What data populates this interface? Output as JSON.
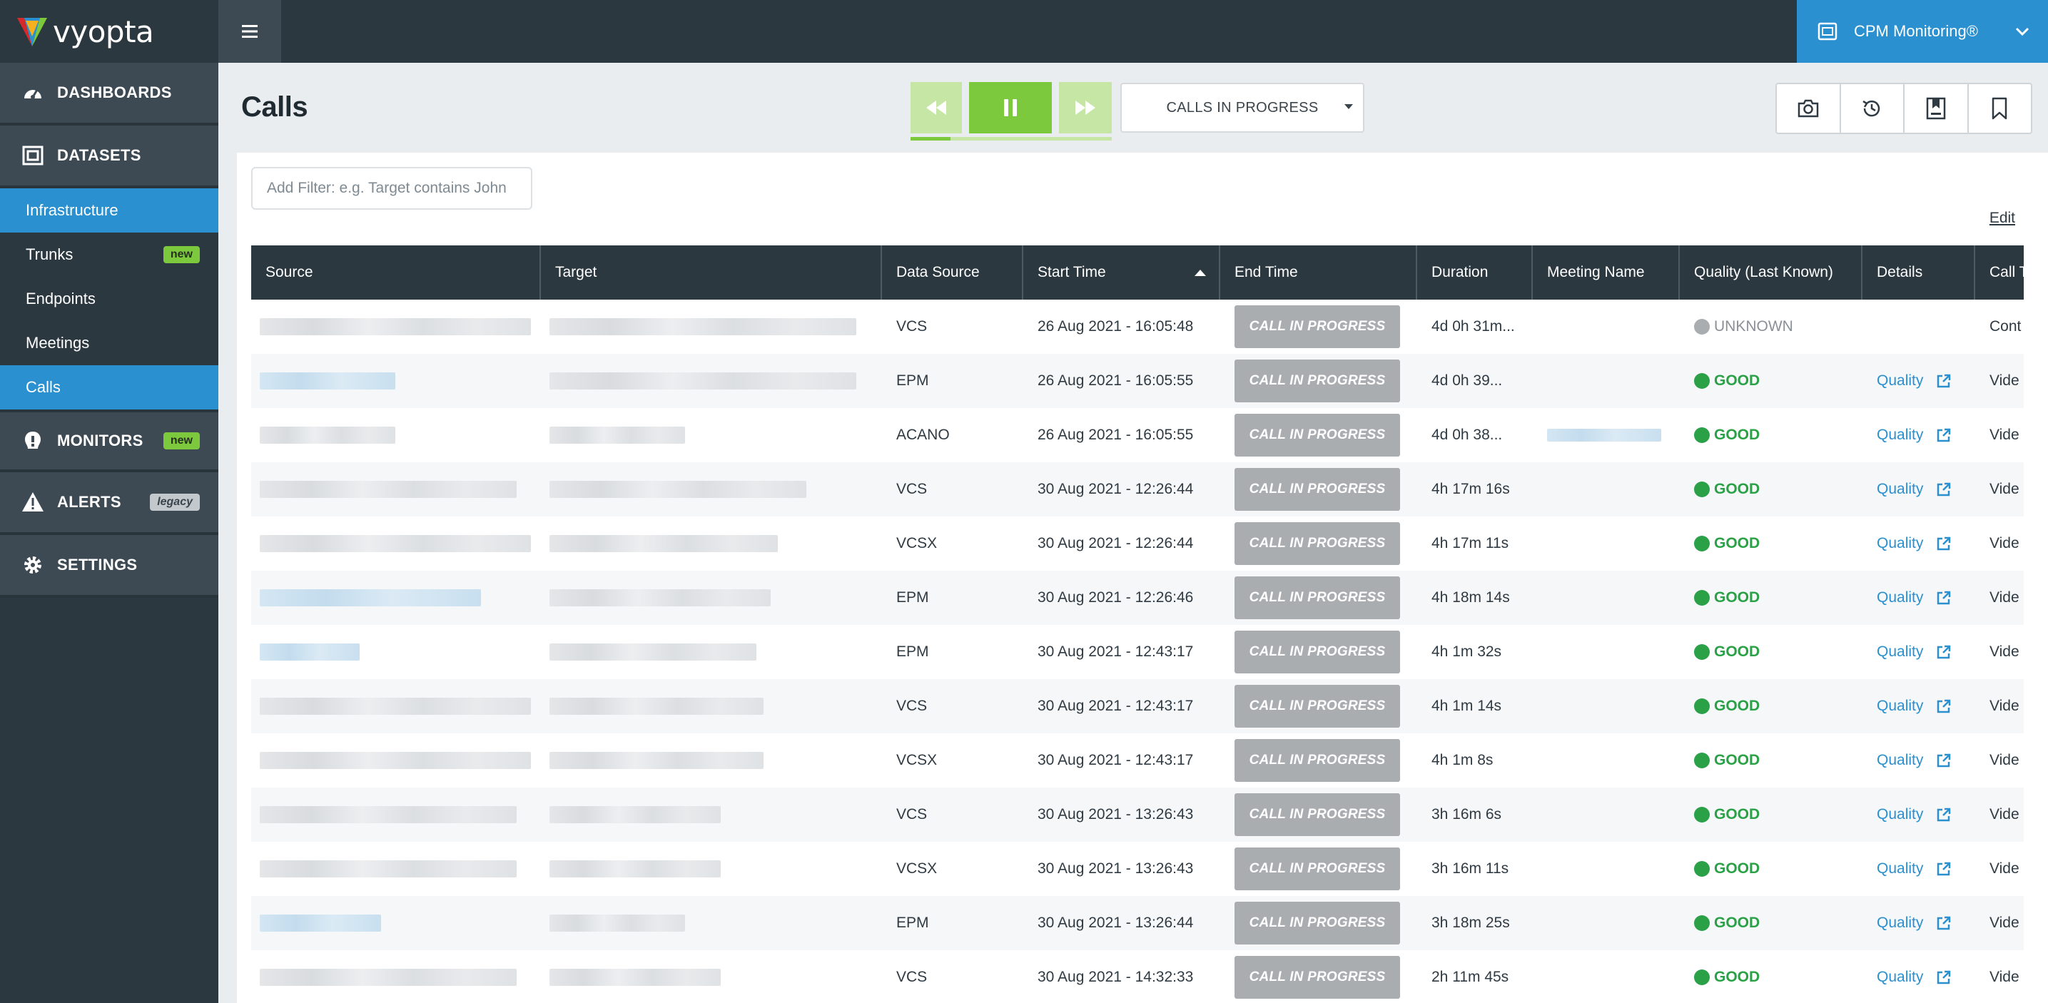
{
  "brand": {
    "name": "vyopta"
  },
  "product": {
    "name": "CPM Monitoring®"
  },
  "sidebar": {
    "dashboards": "DASHBOARDS",
    "datasets": "DATASETS",
    "dataset_items": [
      "Infrastructure",
      "Trunks",
      "Endpoints",
      "Meetings",
      "Calls"
    ],
    "trunks_badge": "new",
    "monitors": "MONITORS",
    "monitors_badge": "new",
    "alerts": "ALERTS",
    "alerts_badge": "legacy",
    "settings": "SETTINGS"
  },
  "page": {
    "title": "Calls"
  },
  "playback": {
    "progress_fraction": 0.2
  },
  "mode_select": {
    "selected": "CALLS IN PROGRESS"
  },
  "filter": {
    "placeholder": "Add Filter: e.g. Target contains John",
    "value": ""
  },
  "edit_label": "Edit",
  "table": {
    "columns": [
      "Source",
      "Target",
      "Data Source",
      "Start Time",
      "End Time",
      "Duration",
      "Meeting Name",
      "Quality (Last Known)",
      "Details",
      "Call T"
    ],
    "sorted_column": "Start Time",
    "rows": [
      {
        "data_source": "VCS",
        "start": "26 Aug 2021 - 16:05:48",
        "end": "CALL IN PROGRESS",
        "duration": "4d 0h 31m...",
        "meeting": "",
        "quality": "UNKNOWN",
        "details": "",
        "call_type": "Cont"
      },
      {
        "data_source": "EPM",
        "start": "26 Aug 2021 - 16:05:55",
        "end": "CALL IN PROGRESS",
        "duration": "4d 0h 39...",
        "meeting": "",
        "quality": "GOOD",
        "details": "Quality",
        "call_type": "Vide"
      },
      {
        "data_source": "ACANO",
        "start": "26 Aug 2021 - 16:05:55",
        "end": "CALL IN PROGRESS",
        "duration": "4d 0h 38...",
        "meeting": "",
        "quality": "GOOD",
        "details": "Quality",
        "call_type": "Vide"
      },
      {
        "data_source": "VCS",
        "start": "30 Aug 2021 - 12:26:44",
        "end": "CALL IN PROGRESS",
        "duration": "4h 17m 16s",
        "meeting": "",
        "quality": "GOOD",
        "details": "Quality",
        "call_type": "Vide"
      },
      {
        "data_source": "VCSX",
        "start": "30 Aug 2021 - 12:26:44",
        "end": "CALL IN PROGRESS",
        "duration": "4h 17m 11s",
        "meeting": "",
        "quality": "GOOD",
        "details": "Quality",
        "call_type": "Vide"
      },
      {
        "data_source": "EPM",
        "start": "30 Aug 2021 - 12:26:46",
        "end": "CALL IN PROGRESS",
        "duration": "4h 18m 14s",
        "meeting": "",
        "quality": "GOOD",
        "details": "Quality",
        "call_type": "Vide"
      },
      {
        "data_source": "EPM",
        "start": "30 Aug 2021 - 12:43:17",
        "end": "CALL IN PROGRESS",
        "duration": "4h 1m 32s",
        "meeting": "",
        "quality": "GOOD",
        "details": "Quality",
        "call_type": "Vide"
      },
      {
        "data_source": "VCS",
        "start": "30 Aug 2021 - 12:43:17",
        "end": "CALL IN PROGRESS",
        "duration": "4h 1m 14s",
        "meeting": "",
        "quality": "GOOD",
        "details": "Quality",
        "call_type": "Vide"
      },
      {
        "data_source": "VCSX",
        "start": "30 Aug 2021 - 12:43:17",
        "end": "CALL IN PROGRESS",
        "duration": "4h 1m 8s",
        "meeting": "",
        "quality": "GOOD",
        "details": "Quality",
        "call_type": "Vide"
      },
      {
        "data_source": "VCS",
        "start": "30 Aug 2021 - 13:26:43",
        "end": "CALL IN PROGRESS",
        "duration": "3h 16m 6s",
        "meeting": "",
        "quality": "GOOD",
        "details": "Quality",
        "call_type": "Vide"
      },
      {
        "data_source": "VCSX",
        "start": "30 Aug 2021 - 13:26:43",
        "end": "CALL IN PROGRESS",
        "duration": "3h 16m 11s",
        "meeting": "",
        "quality": "GOOD",
        "details": "Quality",
        "call_type": "Vide"
      },
      {
        "data_source": "EPM",
        "start": "30 Aug 2021 - 13:26:44",
        "end": "CALL IN PROGRESS",
        "duration": "3h 18m 25s",
        "meeting": "",
        "quality": "GOOD",
        "details": "Quality",
        "call_type": "Vide"
      },
      {
        "data_source": "VCS",
        "start": "30 Aug 2021 - 14:32:33",
        "end": "CALL IN PROGRESS",
        "duration": "2h 11m 45s",
        "meeting": "",
        "quality": "GOOD",
        "details": "Quality",
        "call_type": "Vide"
      }
    ]
  },
  "colors": {
    "sidebar_bg": "#2c3840",
    "accent_blue": "#2a90d0",
    "play_green": "#7cc93e",
    "good_green": "#2aa146",
    "unknown_gray": "#a9adb0"
  },
  "icons": {
    "dashboards": "gauge-icon",
    "datasets": "dataset-icon",
    "monitors": "monitor-icon",
    "alerts": "warning-icon",
    "settings": "gear-icon",
    "menu": "hamburger-icon",
    "product": "product-icon",
    "tools": [
      "camera-icon",
      "history-icon",
      "save-view-icon",
      "bookmark-icon"
    ],
    "details_link": "external-link-icon"
  }
}
